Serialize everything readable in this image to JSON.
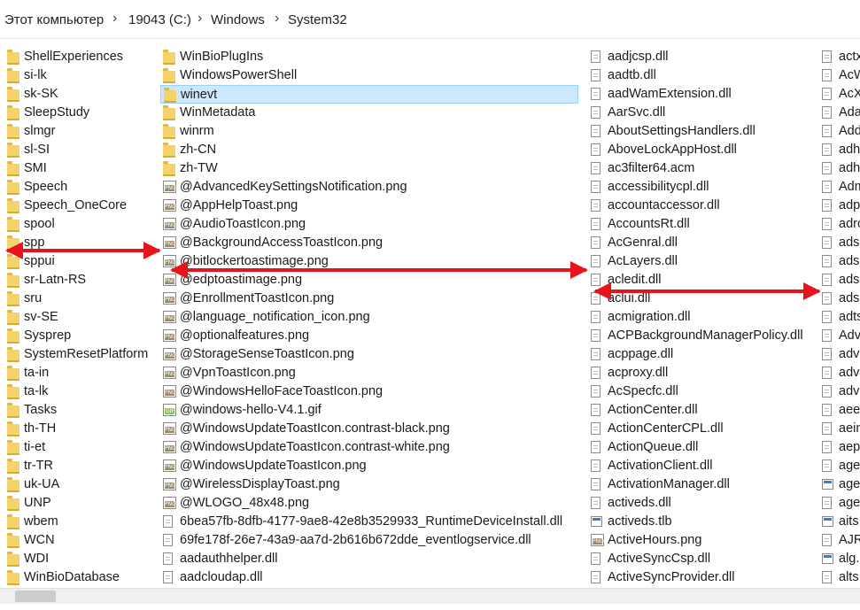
{
  "breadcrumb": {
    "items": [
      "Этот компьютер",
      "19043 (C:)",
      "Windows",
      "System32"
    ],
    "separator": "›"
  },
  "columns": {
    "col1": [
      {
        "name": "ShellExperiences",
        "type": "folder"
      },
      {
        "name": "si-lk",
        "type": "folder"
      },
      {
        "name": "sk-SK",
        "type": "folder"
      },
      {
        "name": "SleepStudy",
        "type": "folder"
      },
      {
        "name": "slmgr",
        "type": "folder"
      },
      {
        "name": "sl-SI",
        "type": "folder"
      },
      {
        "name": "SMI",
        "type": "folder"
      },
      {
        "name": "Speech",
        "type": "folder"
      },
      {
        "name": "Speech_OneCore",
        "type": "folder"
      },
      {
        "name": "spool",
        "type": "folder"
      },
      {
        "name": "spp",
        "type": "folder"
      },
      {
        "name": "sppui",
        "type": "folder"
      },
      {
        "name": "sr-Latn-RS",
        "type": "folder"
      },
      {
        "name": "sru",
        "type": "folder"
      },
      {
        "name": "sv-SE",
        "type": "folder"
      },
      {
        "name": "Sysprep",
        "type": "folder"
      },
      {
        "name": "SystemResetPlatform",
        "type": "folder"
      },
      {
        "name": "ta-in",
        "type": "folder"
      },
      {
        "name": "ta-lk",
        "type": "folder"
      },
      {
        "name": "Tasks",
        "type": "folder"
      },
      {
        "name": "th-TH",
        "type": "folder"
      },
      {
        "name": "ti-et",
        "type": "folder"
      },
      {
        "name": "tr-TR",
        "type": "folder"
      },
      {
        "name": "uk-UA",
        "type": "folder"
      },
      {
        "name": "UNP",
        "type": "folder"
      },
      {
        "name": "wbem",
        "type": "folder"
      },
      {
        "name": "WCN",
        "type": "folder"
      },
      {
        "name": "WDI",
        "type": "folder"
      },
      {
        "name": "WinBioDatabase",
        "type": "folder"
      }
    ],
    "col2": [
      {
        "name": "WinBioPlugIns",
        "type": "folder"
      },
      {
        "name": "WindowsPowerShell",
        "type": "folder"
      },
      {
        "name": "winevt",
        "type": "folder",
        "selected": true
      },
      {
        "name": "WinMetadata",
        "type": "folder"
      },
      {
        "name": "winrm",
        "type": "folder"
      },
      {
        "name": "zh-CN",
        "type": "folder"
      },
      {
        "name": "zh-TW",
        "type": "folder"
      },
      {
        "name": "@AdvancedKeySettingsNotification.png",
        "type": "png"
      },
      {
        "name": "@AppHelpToast.png",
        "type": "png"
      },
      {
        "name": "@AudioToastIcon.png",
        "type": "png"
      },
      {
        "name": "@BackgroundAccessToastIcon.png",
        "type": "png"
      },
      {
        "name": "@bitlockertoastimage.png",
        "type": "png"
      },
      {
        "name": "@edptoastimage.png",
        "type": "png"
      },
      {
        "name": "@EnrollmentToastIcon.png",
        "type": "png"
      },
      {
        "name": "@language_notification_icon.png",
        "type": "png"
      },
      {
        "name": "@optionalfeatures.png",
        "type": "png"
      },
      {
        "name": "@StorageSenseToastIcon.png",
        "type": "png"
      },
      {
        "name": "@VpnToastIcon.png",
        "type": "png"
      },
      {
        "name": "@WindowsHelloFaceToastIcon.png",
        "type": "png"
      },
      {
        "name": "@windows-hello-V4.1.gif",
        "type": "gif"
      },
      {
        "name": "@WindowsUpdateToastIcon.contrast-black.png",
        "type": "png"
      },
      {
        "name": "@WindowsUpdateToastIcon.contrast-white.png",
        "type": "png"
      },
      {
        "name": "@WindowsUpdateToastIcon.png",
        "type": "png"
      },
      {
        "name": "@WirelessDisplayToast.png",
        "type": "png"
      },
      {
        "name": "@WLOGO_48x48.png",
        "type": "png"
      },
      {
        "name": "6bea57fb-8dfb-4177-9ae8-42e8b3529933_RuntimeDeviceInstall.dll",
        "type": "file"
      },
      {
        "name": "69fe178f-26e7-43a9-aa7d-2b616b672dde_eventlogservice.dll",
        "type": "file"
      },
      {
        "name": "aadauthhelper.dll",
        "type": "file"
      },
      {
        "name": "aadcloudap.dll",
        "type": "file"
      }
    ],
    "col3": [
      {
        "name": "aadjcsp.dll",
        "type": "file"
      },
      {
        "name": "aadtb.dll",
        "type": "file"
      },
      {
        "name": "aadWamExtension.dll",
        "type": "file"
      },
      {
        "name": "AarSvc.dll",
        "type": "file"
      },
      {
        "name": "AboutSettingsHandlers.dll",
        "type": "file"
      },
      {
        "name": "AboveLockAppHost.dll",
        "type": "file"
      },
      {
        "name": "ac3filter64.acm",
        "type": "file"
      },
      {
        "name": "accessibilitycpl.dll",
        "type": "file"
      },
      {
        "name": "accountaccessor.dll",
        "type": "file"
      },
      {
        "name": "AccountsRt.dll",
        "type": "file"
      },
      {
        "name": "AcGenral.dll",
        "type": "file"
      },
      {
        "name": "AcLayers.dll",
        "type": "file"
      },
      {
        "name": "acledit.dll",
        "type": "file"
      },
      {
        "name": "aclui.dll",
        "type": "file"
      },
      {
        "name": "acmigration.dll",
        "type": "file"
      },
      {
        "name": "ACPBackgroundManagerPolicy.dll",
        "type": "file"
      },
      {
        "name": "acppage.dll",
        "type": "file"
      },
      {
        "name": "acproxy.dll",
        "type": "file"
      },
      {
        "name": "AcSpecfc.dll",
        "type": "file"
      },
      {
        "name": "ActionCenter.dll",
        "type": "file"
      },
      {
        "name": "ActionCenterCPL.dll",
        "type": "file"
      },
      {
        "name": "ActionQueue.dll",
        "type": "file"
      },
      {
        "name": "ActivationClient.dll",
        "type": "file"
      },
      {
        "name": "ActivationManager.dll",
        "type": "file"
      },
      {
        "name": "activeds.dll",
        "type": "file"
      },
      {
        "name": "activeds.tlb",
        "type": "tlb"
      },
      {
        "name": "ActiveHours.png",
        "type": "png"
      },
      {
        "name": "ActiveSyncCsp.dll",
        "type": "file"
      },
      {
        "name": "ActiveSyncProvider.dll",
        "type": "file"
      }
    ],
    "col4": [
      {
        "name": "actx",
        "type": "file"
      },
      {
        "name": "AcW",
        "type": "file"
      },
      {
        "name": "AcX",
        "type": "file"
      },
      {
        "name": "Ada",
        "type": "file"
      },
      {
        "name": "Add",
        "type": "file"
      },
      {
        "name": "adh",
        "type": "file"
      },
      {
        "name": "adh",
        "type": "file"
      },
      {
        "name": "Adm",
        "type": "file"
      },
      {
        "name": "adp",
        "type": "file"
      },
      {
        "name": "adro",
        "type": "file"
      },
      {
        "name": "adsl",
        "type": "file"
      },
      {
        "name": "adsl",
        "type": "file"
      },
      {
        "name": "adsn",
        "type": "file"
      },
      {
        "name": "adsn",
        "type": "file"
      },
      {
        "name": "adts",
        "type": "file"
      },
      {
        "name": "Adv",
        "type": "file"
      },
      {
        "name": "adv",
        "type": "file"
      },
      {
        "name": "adv",
        "type": "file"
      },
      {
        "name": "adv",
        "type": "file"
      },
      {
        "name": "aee",
        "type": "file"
      },
      {
        "name": "aein",
        "type": "file"
      },
      {
        "name": "aep",
        "type": "file"
      },
      {
        "name": "age",
        "type": "file"
      },
      {
        "name": "age",
        "type": "tlb"
      },
      {
        "name": "age",
        "type": "file"
      },
      {
        "name": "aits",
        "type": "tlb"
      },
      {
        "name": "AJR",
        "type": "file"
      },
      {
        "name": "alg.",
        "type": "tlb"
      },
      {
        "name": "alts",
        "type": "file"
      }
    ]
  },
  "colors": {
    "folder": "#f4d36b",
    "selection": "#cce8ff",
    "arrow": "#e8141c"
  }
}
